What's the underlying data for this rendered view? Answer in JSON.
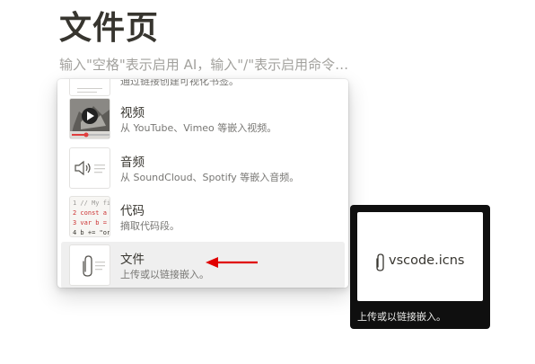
{
  "page": {
    "title": "文件页",
    "placeholder": "输入\"空格\"表示启用 AI，输入\"/\"表示启用命令…"
  },
  "menu": {
    "items": [
      {
        "title": "",
        "desc": "通过链接创建可视化书签。",
        "icon": "bookmark-icon"
      },
      {
        "title": "视频",
        "desc": "从 YouTube、Vimeo 等嵌入视频。",
        "icon": "video-thumbnail-icon"
      },
      {
        "title": "音频",
        "desc": "从 SoundCloud、Spotify 等嵌入音频。",
        "icon": "speaker-icon"
      },
      {
        "title": "代码",
        "desc": "摘取代码段。",
        "icon": "code-icon"
      },
      {
        "title": "文件",
        "desc": "上传或以链接嵌入。",
        "icon": "paperclip-icon"
      }
    ],
    "code_preview": [
      "1 // My fi",
      "2 const a",
      "3 var b =",
      "4 b += \"or"
    ],
    "selected_index": 4
  },
  "tooltip": {
    "file_name": "vscode.icns",
    "caption": "上传或以链接嵌入。"
  },
  "colors": {
    "annotation_arrow": "#e00000",
    "selected_background": "#efefef",
    "tooltip_background": "#0f0f0f"
  }
}
